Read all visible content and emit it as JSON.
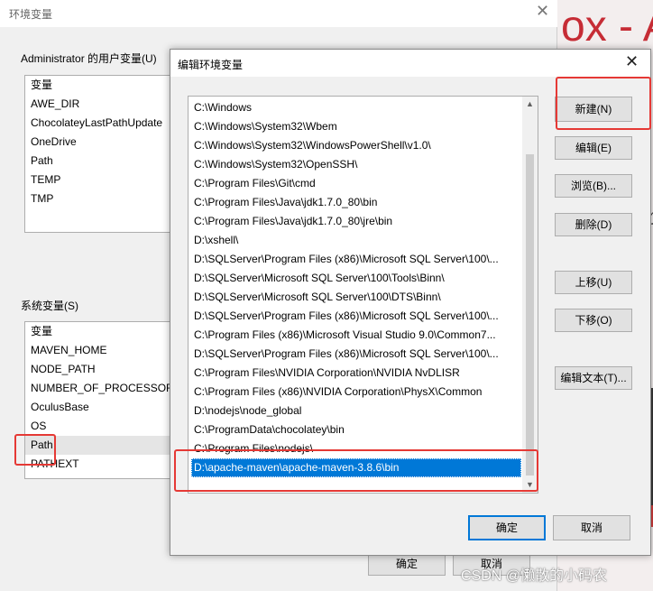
{
  "background": {
    "headline": "ox - A",
    "extra_text": "り"
  },
  "parent_window": {
    "title": "环境变量",
    "close": "✕",
    "user_vars": {
      "label": "Administrator 的用户变量(U)",
      "header": "变量",
      "items": [
        "AWE_DIR",
        "ChocolateyLastPathUpdate",
        "OneDrive",
        "Path",
        "TEMP",
        "TMP"
      ]
    },
    "system_vars": {
      "label": "系统变量(S)",
      "header": "变量",
      "items": [
        "MAVEN_HOME",
        "NODE_PATH",
        "NUMBER_OF_PROCESSORS",
        "OculusBase",
        "OS",
        "Path",
        "PATHEXT"
      ],
      "selected": "Path"
    },
    "ok_label": "确定",
    "cancel_label": "取消"
  },
  "dialog": {
    "title": "编辑环境变量",
    "close": "✕",
    "paths": [
      "C:\\Windows",
      "C:\\Windows\\System32\\Wbem",
      "C:\\Windows\\System32\\WindowsPowerShell\\v1.0\\",
      "C:\\Windows\\System32\\OpenSSH\\",
      "C:\\Program Files\\Git\\cmd",
      "C:\\Program Files\\Java\\jdk1.7.0_80\\bin",
      "C:\\Program Files\\Java\\jdk1.7.0_80\\jre\\bin",
      "D:\\xshell\\",
      "D:\\SQLServer\\Program Files (x86)\\Microsoft SQL Server\\100\\...",
      "D:\\SQLServer\\Microsoft SQL Server\\100\\Tools\\Binn\\",
      "D:\\SQLServer\\Microsoft SQL Server\\100\\DTS\\Binn\\",
      "D:\\SQLServer\\Program Files (x86)\\Microsoft SQL Server\\100\\...",
      "C:\\Program Files (x86)\\Microsoft Visual Studio 9.0\\Common7...",
      "D:\\SQLServer\\Program Files (x86)\\Microsoft SQL Server\\100\\...",
      "C:\\Program Files\\NVIDIA Corporation\\NVIDIA NvDLISR",
      "C:\\Program Files (x86)\\NVIDIA Corporation\\PhysX\\Common",
      "D:\\nodejs\\node_global",
      "C:\\ProgramData\\chocolatey\\bin",
      "C:\\Program Files\\nodejs\\",
      "D:\\apache-maven\\apache-maven-3.8.6\\bin"
    ],
    "selected_path": "D:\\apache-maven\\apache-maven-3.8.6\\bin",
    "buttons": {
      "new": "新建(N)",
      "edit": "编辑(E)",
      "browse": "浏览(B)...",
      "delete": "删除(D)",
      "move_up": "上移(U)",
      "move_down": "下移(O)",
      "edit_text": "编辑文本(T)..."
    },
    "ok_label": "确定",
    "cancel_label": "取消"
  },
  "colors": {
    "selection": "#0078d7",
    "annotation_red": "#e53935"
  },
  "watermark": "CSDN @懒散的小码农"
}
